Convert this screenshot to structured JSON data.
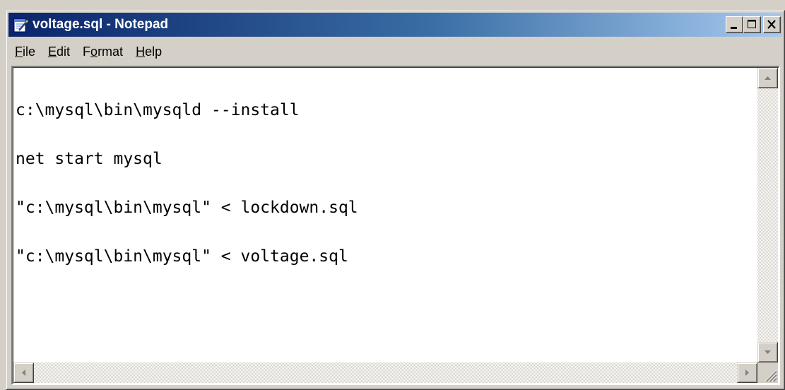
{
  "window": {
    "title": "voltage.sql - Notepad",
    "icon": "notepad-icon"
  },
  "caption_buttons": [
    {
      "name": "minimize-button",
      "icon": "minimize-icon"
    },
    {
      "name": "maximize-button",
      "icon": "maximize-icon"
    },
    {
      "name": "close-button",
      "icon": "close-icon"
    }
  ],
  "menu": {
    "file": {
      "u": "F",
      "rest": "ile"
    },
    "edit": {
      "u": "E",
      "rest": "dit"
    },
    "format": {
      "pre": "F",
      "u": "o",
      "rest": "rmat"
    },
    "help": {
      "u": "H",
      "rest": "elp"
    }
  },
  "editor": {
    "lines": [
      "c:\\mysql\\bin\\mysqld --install",
      "net start mysql",
      "\"c:\\mysql\\bin\\mysql\" < lockdown.sql",
      "\"c:\\mysql\\bin\\mysql\" < voltage.sql"
    ]
  },
  "colors": {
    "title_gradient_start": "#0a246a",
    "title_gradient_end": "#a6caf0",
    "chrome": "#d4d0c8"
  }
}
